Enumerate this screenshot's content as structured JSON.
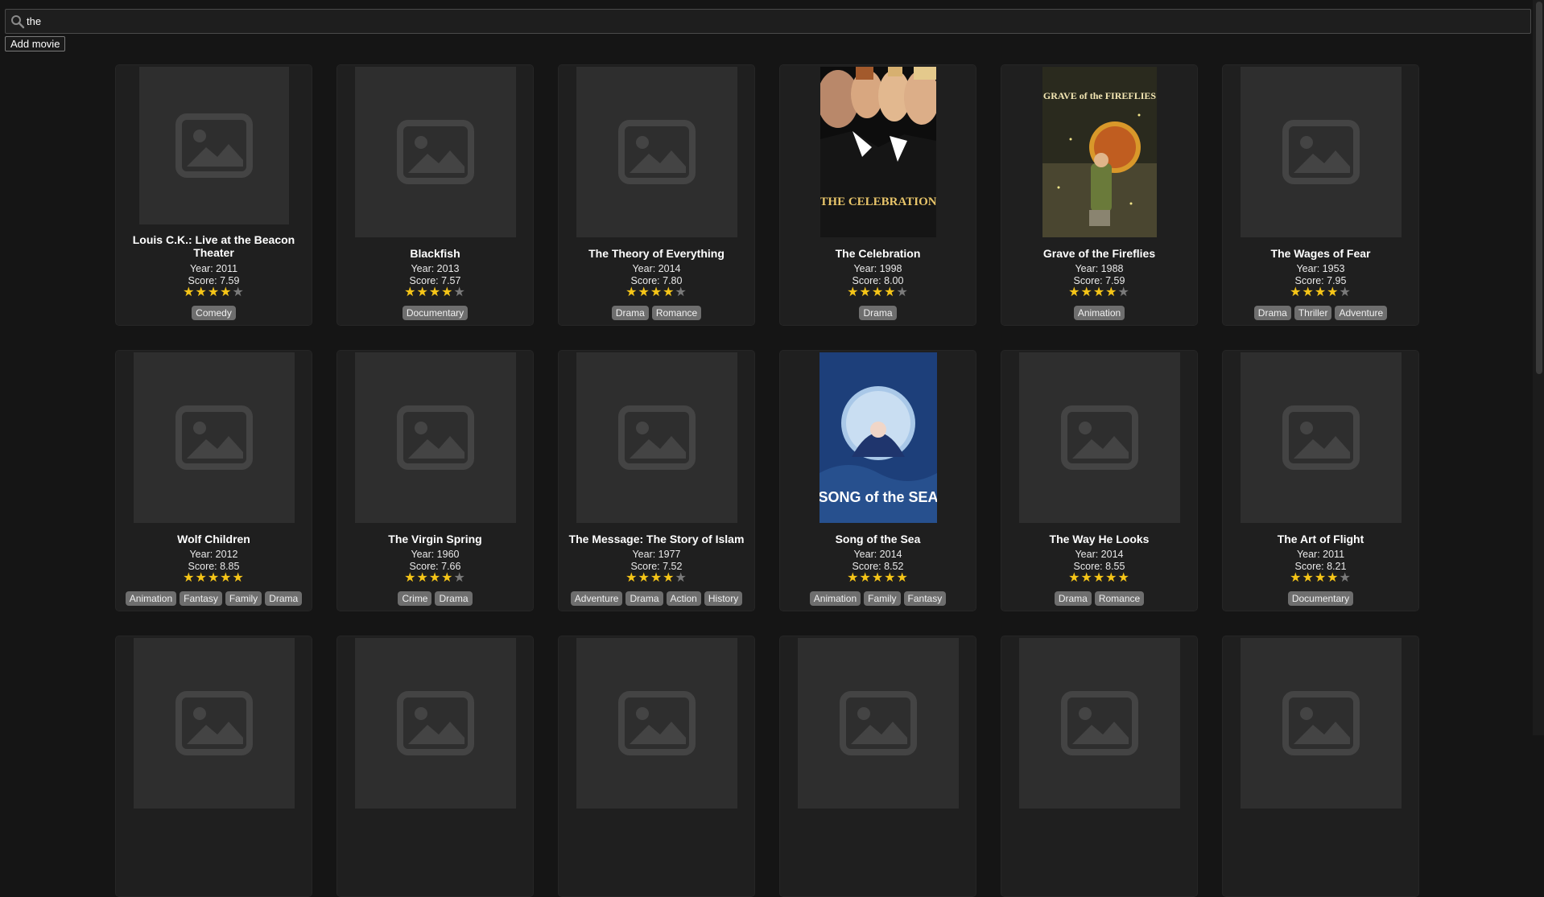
{
  "search": {
    "value": "the",
    "placeholder": ""
  },
  "toolbar": {
    "add_movie_label": "Add movie"
  },
  "colors": {
    "background": "#151515",
    "card": "#1f1f1f",
    "star": "#f5c518",
    "tag": "#6e6e6e"
  },
  "movies": [
    {
      "title": "Louis C.K.: Live at the Beacon Theater",
      "year": "Year: 2011",
      "score": "Score: 7.59",
      "stars": 4,
      "genres": [
        "Comedy"
      ],
      "poster": "placeholder"
    },
    {
      "title": "Blackfish",
      "year": "Year: 2013",
      "score": "Score: 7.57",
      "stars": 4,
      "genres": [
        "Documentary"
      ],
      "poster": "placeholder"
    },
    {
      "title": "The Theory of Everything",
      "year": "Year: 2014",
      "score": "Score: 7.80",
      "stars": 4,
      "genres": [
        "Drama",
        "Romance"
      ],
      "poster": "placeholder"
    },
    {
      "title": "The Celebration",
      "year": "Year: 1998",
      "score": "Score: 8.00",
      "stars": 4,
      "genres": [
        "Drama"
      ],
      "poster": "celebration",
      "poster_text": "THE CELEBRATION"
    },
    {
      "title": "Grave of the Fireflies",
      "year": "Year: 1988",
      "score": "Score: 7.59",
      "stars": 4,
      "genres": [
        "Animation"
      ],
      "poster": "fireflies",
      "poster_text": "GRAVE of the FIREFLIES"
    },
    {
      "title": "The Wages of Fear",
      "year": "Year: 1953",
      "score": "Score: 7.95",
      "stars": 4,
      "genres": [
        "Drama",
        "Thriller",
        "Adventure"
      ],
      "poster": "placeholder"
    },
    {
      "title": "Wolf Children",
      "year": "Year: 2012",
      "score": "Score: 8.85",
      "stars": 5,
      "genres": [
        "Animation",
        "Fantasy",
        "Family",
        "Drama"
      ],
      "poster": "placeholder"
    },
    {
      "title": "The Virgin Spring",
      "year": "Year: 1960",
      "score": "Score: 7.66",
      "stars": 4,
      "genres": [
        "Crime",
        "Drama"
      ],
      "poster": "placeholder"
    },
    {
      "title": "The Message: The Story of Islam",
      "year": "Year: 1977",
      "score": "Score: 7.52",
      "stars": 4,
      "genres": [
        "Adventure",
        "Drama",
        "Action",
        "History"
      ],
      "poster": "placeholder"
    },
    {
      "title": "Song of the Sea",
      "year": "Year: 2014",
      "score": "Score: 8.52",
      "stars": 5,
      "genres": [
        "Animation",
        "Family",
        "Fantasy"
      ],
      "poster": "sea",
      "poster_text": "SONG of the SEA"
    },
    {
      "title": "The Way He Looks",
      "year": "Year: 2014",
      "score": "Score: 8.55",
      "stars": 5,
      "genres": [
        "Drama",
        "Romance"
      ],
      "poster": "placeholder"
    },
    {
      "title": "The Art of Flight",
      "year": "Year: 2011",
      "score": "Score: 8.21",
      "stars": 4,
      "genres": [
        "Documentary"
      ],
      "poster": "placeholder"
    },
    {
      "title": "",
      "year": "",
      "score": "",
      "stars": 0,
      "genres": [],
      "poster": "placeholder"
    },
    {
      "title": "",
      "year": "",
      "score": "",
      "stars": 0,
      "genres": [],
      "poster": "placeholder"
    },
    {
      "title": "",
      "year": "",
      "score": "",
      "stars": 0,
      "genres": [],
      "poster": "placeholder"
    },
    {
      "title": "",
      "year": "",
      "score": "",
      "stars": 0,
      "genres": [],
      "poster": "placeholder"
    },
    {
      "title": "",
      "year": "",
      "score": "",
      "stars": 0,
      "genres": [],
      "poster": "placeholder"
    },
    {
      "title": "",
      "year": "",
      "score": "",
      "stars": 0,
      "genres": [],
      "poster": "placeholder"
    }
  ]
}
